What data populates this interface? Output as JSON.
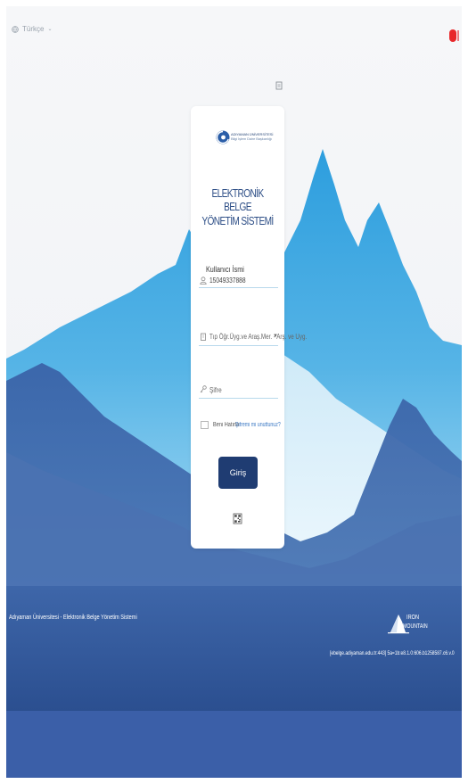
{
  "language": {
    "label": "Türkçe"
  },
  "colors": {
    "primary": "#1f3c72",
    "title": "#2d4e86",
    "link": "#3a78c4",
    "badge": "#e8272a"
  },
  "logo": {
    "line1": "ADIYAMAN ÜNİVERSİTESİ",
    "line2": "Bilgi İşlem Daire Başkanlığı"
  },
  "title": {
    "line1": "ELEKTRONİK BELGE",
    "line2": "YÖNETİM SİSTEMİ"
  },
  "form": {
    "username_label": "Kullanıcı İsmi",
    "username_value": "15049337888",
    "unit_value": "Tıp Öğr.Üyg.ve Araş.Mer. - Arş. ve Uyg.",
    "password_placeholder": "Şifre",
    "remember_label": "Beni Hatırla",
    "forgot_label": "Şifremi mi unuttunuz?",
    "login_label": "Giriş"
  },
  "icons": {
    "language": "globe-icon",
    "user": "user-icon",
    "unit": "building-icon",
    "password": "key-icon",
    "qr": "qr-code-icon",
    "top": "document-icon"
  },
  "footer": {
    "system_name": "Adıyaman Üniversitesi - Elektronik Belge Yönetim Sistemi",
    "vendor_line1": "IRON",
    "vendor_line2": "MOUNTAIN",
    "version": "[ebelge.adiyaman.edu.tr:443] 5a=1b:e8.1.0:606.b1258587.c6.v.0"
  }
}
